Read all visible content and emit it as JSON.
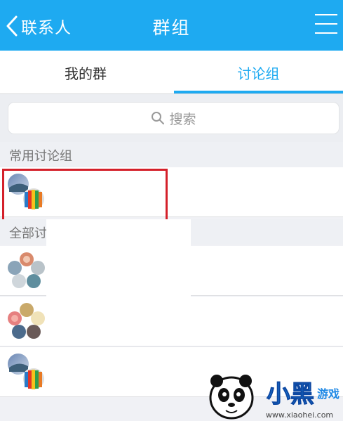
{
  "header": {
    "back_label": "联系人",
    "title": "群组"
  },
  "tabs": {
    "my_groups": "我的群",
    "discussion_groups": "讨论组"
  },
  "search": {
    "placeholder": "搜索"
  },
  "sections": {
    "frequent": "常用讨论组",
    "all": "全部讨"
  },
  "watermark": {
    "brand": "小黑游戏",
    "url": "www.xiaohei.com"
  },
  "colors": {
    "accent": "#1eaaf1",
    "highlight_border": "#d4202a"
  }
}
